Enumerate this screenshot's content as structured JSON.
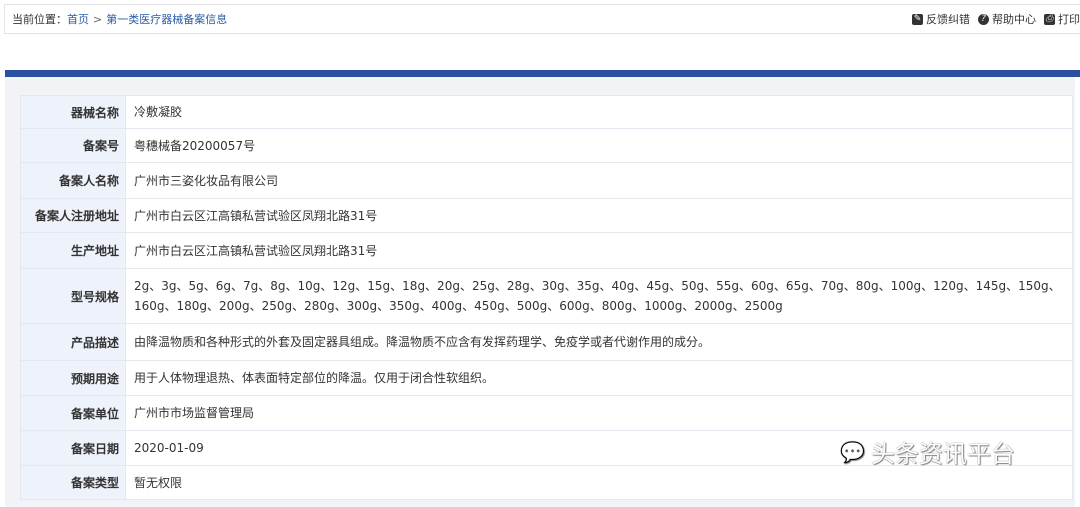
{
  "breadcrumb": {
    "prefix": "当前位置：",
    "home": "首页",
    "sep": ">",
    "current": "第一类医疗器械备案信息"
  },
  "tools": [
    {
      "icon": "edit-icon",
      "label": "反馈纠错"
    },
    {
      "icon": "help-icon",
      "label": "帮助中心"
    },
    {
      "icon": "print-icon",
      "label": "打印"
    }
  ],
  "rows": [
    {
      "label": "器械名称",
      "value": "冷敷凝胶"
    },
    {
      "label": "备案号",
      "value": "粤穗械备20200057号"
    },
    {
      "label": "备案人名称",
      "value": "广州市三姿化妆品有限公司"
    },
    {
      "label": "备案人注册地址",
      "value": "广州市白云区江高镇私营试验区凤翔北路31号"
    },
    {
      "label": "生产地址",
      "value": "广州市白云区江高镇私营试验区凤翔北路31号"
    },
    {
      "label": "型号规格",
      "value": "2g、3g、5g、6g、7g、8g、10g、12g、15g、18g、20g、25g、28g、30g、35g、40g、45g、50g、55g、60g、65g、70g、80g、100g、120g、145g、150g、160g、180g、200g、250g、280g、300g、350g、400g、450g、500g、600g、800g、1000g、2000g、2500g"
    },
    {
      "label": "产品描述",
      "value": "由降温物质和各种形式的外套及固定器具组成。降温物质不应含有发挥药理学、免疫学或者代谢作用的成分。"
    },
    {
      "label": "预期用途",
      "value": "用于人体物理退热、体表面特定部位的降温。仅用于闭合性软组织。"
    },
    {
      "label": "备案单位",
      "value": "广州市市场监督管理局"
    },
    {
      "label": "备案日期",
      "value": "2020-01-09"
    },
    {
      "label": "备案类型",
      "value": "暂无权限"
    }
  ],
  "watermark": "头条资讯平台"
}
